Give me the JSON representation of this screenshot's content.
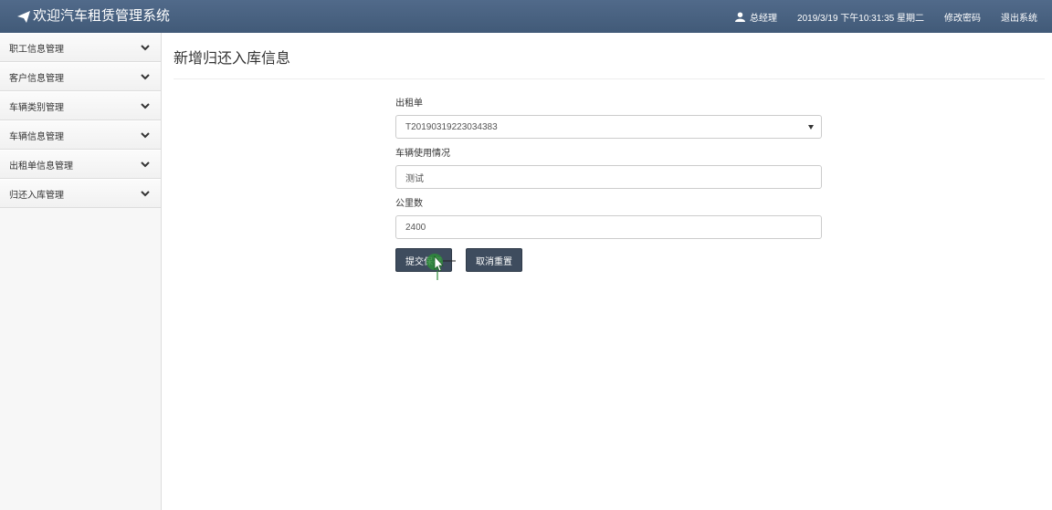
{
  "header": {
    "brand": "欢迎汽车租赁管理系统",
    "user": "总经理",
    "datetime": "2019/3/19 下午10:31:35 星期二",
    "change_password": "修改密码",
    "logout": "退出系统"
  },
  "sidebar": {
    "items": [
      {
        "label": "职工信息管理"
      },
      {
        "label": "客户信息管理"
      },
      {
        "label": "车辆类别管理"
      },
      {
        "label": "车辆信息管理"
      },
      {
        "label": "出租单信息管理"
      },
      {
        "label": "归还入库管理"
      }
    ]
  },
  "main": {
    "title": "新增归还入库信息",
    "form": {
      "rental_order_label": "出租单",
      "rental_order_value": "T20190319223034383",
      "vehicle_usage_label": "车辆使用情况",
      "vehicle_usage_value": "测试",
      "mileage_label": "公里数",
      "mileage_value": "2400",
      "submit_label": "提交保存",
      "reset_label": "取消重置"
    }
  },
  "colors": {
    "header_bg": "#4b6282",
    "button_bg": "#3e4c5e",
    "cursor_highlight": "#2e8b3a"
  }
}
